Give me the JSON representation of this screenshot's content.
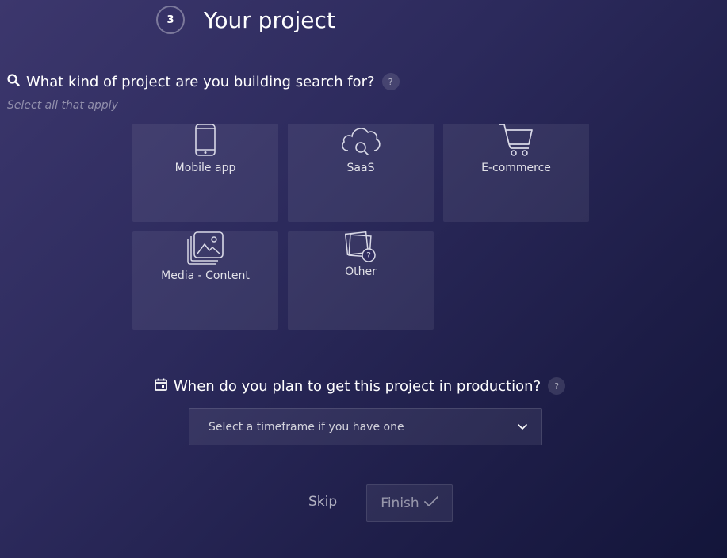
{
  "step": {
    "number": "3",
    "title": "Your project"
  },
  "project_question": {
    "text": "What kind of project are you building search for?",
    "help": "?",
    "hint": "Select all that apply",
    "options": [
      {
        "label": "Mobile app",
        "icon": "mobile-phone-icon"
      },
      {
        "label": "SaaS",
        "icon": "cloud-search-icon"
      },
      {
        "label": "E-commerce",
        "icon": "shopping-cart-icon"
      },
      {
        "label": "Media - Content",
        "icon": "image-gallery-icon"
      },
      {
        "label": "Other",
        "icon": "question-notes-icon"
      }
    ]
  },
  "timeframe_question": {
    "text": "When do you plan to get this project in production?",
    "help": "?",
    "select_placeholder": "Select a timeframe if you have one"
  },
  "actions": {
    "skip_label": "Skip",
    "finish_label": "Finish"
  }
}
